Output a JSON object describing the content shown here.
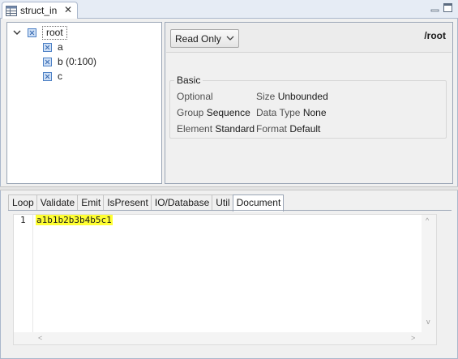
{
  "window": {
    "tab_title": "struct_in",
    "tab_close_glyph": "✕",
    "icons": [
      "table-editor-icon",
      "close-icon",
      "minimize-icon",
      "maximize-icon"
    ]
  },
  "tree": {
    "root": {
      "label": "root",
      "expanded": true,
      "checked": true
    },
    "children": [
      {
        "label": "a",
        "checked": true
      },
      {
        "label": "b (0:100)",
        "checked": true
      },
      {
        "label": "c",
        "checked": true
      }
    ]
  },
  "properties": {
    "mode_select": {
      "value": "Read Only",
      "options": [
        "Read Only"
      ]
    },
    "path": "/root",
    "basic": {
      "title": "Basic",
      "rows": [
        {
          "left_key": "Optional",
          "left_val": "",
          "right_key": "Size",
          "right_val": "Unbounded"
        },
        {
          "left_key": "Group",
          "left_val": "Sequence",
          "right_key": "Data Type",
          "right_val": "None"
        },
        {
          "left_key": "Element",
          "left_val": "Standard",
          "right_key": "Format",
          "right_val": "Default"
        }
      ]
    }
  },
  "bottom_tabs": [
    {
      "label": "Loop",
      "active": false
    },
    {
      "label": "Validate",
      "active": false
    },
    {
      "label": "Emit",
      "active": false
    },
    {
      "label": "IsPresent",
      "active": false
    },
    {
      "label": "IO/Database",
      "active": false
    },
    {
      "label": "Util",
      "active": false
    },
    {
      "label": "Document",
      "active": true
    }
  ],
  "editor": {
    "lines": [
      {
        "number": "1",
        "text": "a1b1b2b3b4b5c1",
        "highlight_color": "#ffff33"
      }
    ],
    "scroll_arrows": {
      "up": "^",
      "down": "v",
      "left": "<",
      "right": ">"
    }
  },
  "colors": {
    "tab_bar": "#e6ecf5",
    "checkbox_fill": "#cfe0f6",
    "checkbox_border": "#4b7fc4",
    "highlight": "#ffff33"
  }
}
